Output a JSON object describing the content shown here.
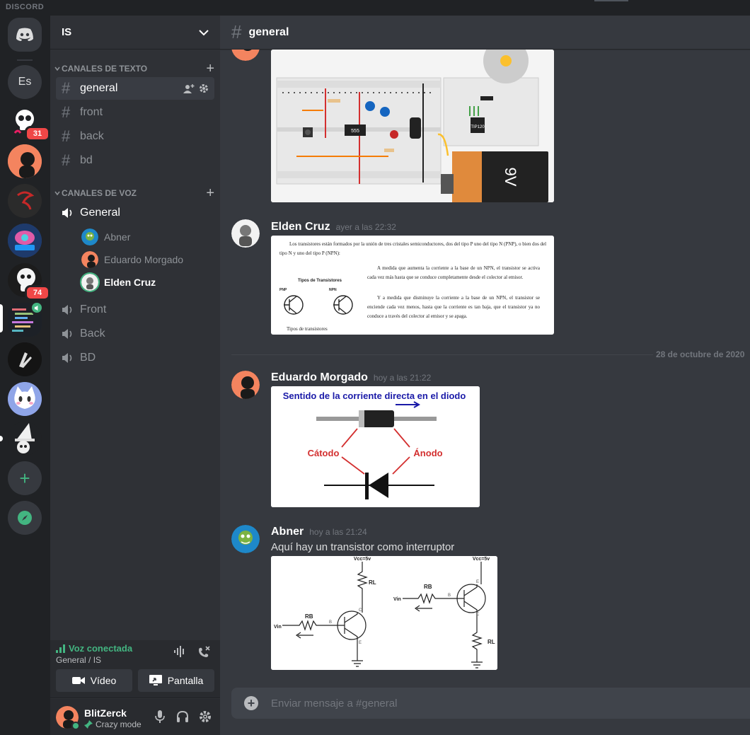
{
  "app": {
    "wordmark": "DISCORD"
  },
  "guilds": {
    "es_label": "Es",
    "badge_a": "31",
    "badge_b": "74",
    "add_label": "+"
  },
  "server": {
    "name": "IS"
  },
  "categories": {
    "text": "CANALES DE TEXTO",
    "voice": "CANALES DE VOZ"
  },
  "text_channels": [
    "general",
    "front",
    "back",
    "bd"
  ],
  "voice_channels": [
    "General",
    "Front",
    "Back",
    "BD"
  ],
  "voice_users": [
    "Abner",
    "Eduardo Morgado",
    "Elden Cruz"
  ],
  "voice_panel": {
    "status": "Voz conectada",
    "location": "General / IS",
    "video_label": "Vídeo",
    "screen_label": "Pantalla"
  },
  "user": {
    "name": "BlitZerck",
    "status": "Crazy mode"
  },
  "channel": {
    "name": "general"
  },
  "messages": [
    {
      "author": "Elden Cruz",
      "timestamp": "ayer a las 22:32",
      "doc": {
        "intro": "Los transistores están formados por la unión de tres cristales semiconductores, dos del tipo P uno del tipo N (PNP), o bien dos del tipo N y uno del tipo P (NPN):",
        "title": "Tipos de Transistores",
        "pnp": "PNP",
        "npn": "NPN",
        "caption": "Tipos de transistores",
        "p1": "A medida que aumenta la corriente a la base de un NPN, el transistor se activa cada vez más hasta que se conduce completamente desde el colector al emisor.",
        "p2": "Y a medida que disminuye la corriente a la base de un NPN, el transistor se enciende cada vez menos, hasta que la corriente es tan baja, que el transistor ya no conduce a través del colector al emisor y se apaga."
      }
    },
    {
      "author": "Eduardo Morgado",
      "timestamp": "hoy a las 21:22",
      "diode": {
        "title": "Sentido de la corriente directa en el diodo",
        "cathode": "Cátodo",
        "anode": "Ánodo"
      }
    },
    {
      "author": "Abner",
      "timestamp": "hoy a las 21:24",
      "text": "Aquí hay un transistor como interruptor",
      "circuit": {
        "vcc1": "Vcc=5v",
        "vcc2": "Vcc=5v",
        "rl": "RL",
        "rb": "RB",
        "vin": "Vin",
        "b": "B",
        "c": "C",
        "e": "E"
      }
    }
  ],
  "date_divider": "28 de octubre de 2020",
  "breadboard": {
    "chip": "555",
    "transistor": "TIP120",
    "battery": "9V"
  },
  "composer": {
    "placeholder": "Enviar mensaje a #general"
  },
  "colors": {
    "accent": "#7289da",
    "online": "#43b581",
    "danger": "#f04747",
    "bg_main": "#36393f",
    "bg_sidebar": "#2f3136",
    "bg_rail": "#202225"
  }
}
